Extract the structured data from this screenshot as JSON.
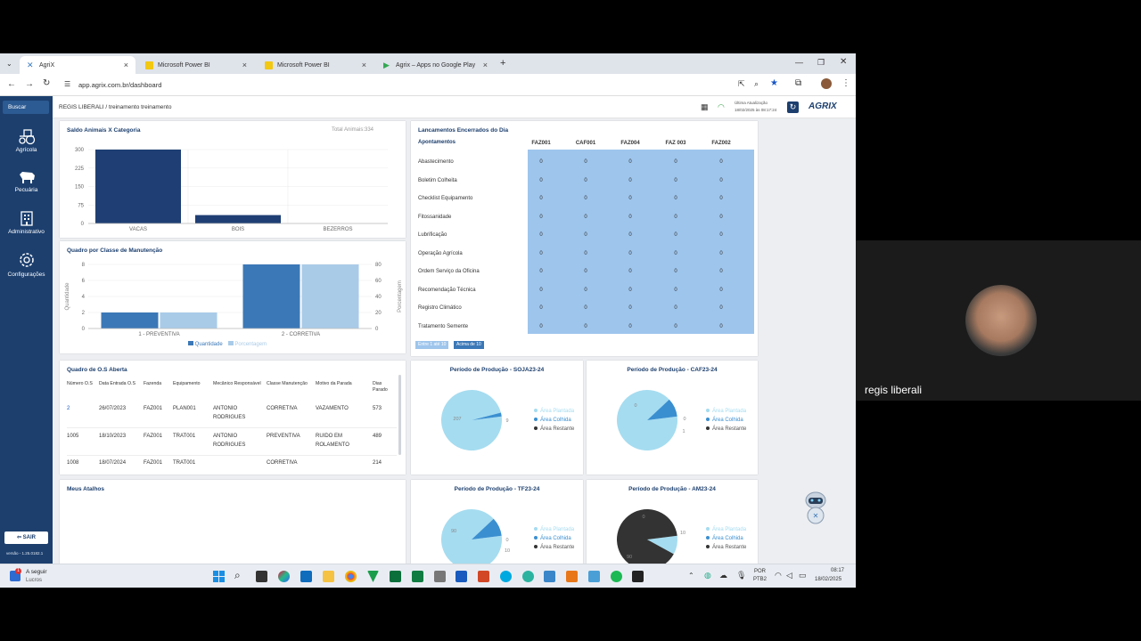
{
  "browser": {
    "tabs": [
      {
        "label": "AgriX"
      },
      {
        "label": "Microsoft Power BI"
      },
      {
        "label": "Microsoft Power BI"
      },
      {
        "label": "Agrix – Apps no Google Play"
      }
    ],
    "url": "app.agrix.com.br/dashboard"
  },
  "sidebar": {
    "search_label": "Buscar",
    "items": [
      {
        "label": "Agrícola",
        "icon": "tractor-icon"
      },
      {
        "label": "Pecuária",
        "icon": "cow-icon"
      },
      {
        "label": "Administrativo",
        "icon": "building-icon"
      },
      {
        "label": "Configurações",
        "icon": "gear-icon"
      }
    ],
    "logout_label": "SAIR",
    "version": "versão - 1.25.0182.1"
  },
  "header": {
    "breadcrumb": "REGIS LIBERALI / treinamento treinamento",
    "update_label": "Última Atualização",
    "update_time": "18/02/2025 às 08:17:24",
    "logo": "AGRIX"
  },
  "animals_card": {
    "title": "Saldo Animais X Categoria",
    "total": "Total Animais:334"
  },
  "maintenance_card": {
    "title": "Quadro por Classe de Manutenção",
    "legend_qty": "Quantidade",
    "legend_pct": "Porcentagem"
  },
  "releases_card": {
    "title": "Lancamentos Encerrados do Dia",
    "col_header": "Apontamentos",
    "farms": [
      "FAZ001",
      "CAF001",
      "FAZ004",
      "FAZ 003",
      "FAZ002"
    ],
    "rows": [
      {
        "label": "Abastecimento",
        "values": [
          "0",
          "0",
          "0",
          "0",
          "0"
        ]
      },
      {
        "label": "Boletim Colheita",
        "values": [
          "0",
          "0",
          "0",
          "0",
          "0"
        ]
      },
      {
        "label": "Checklist Equipamento",
        "values": [
          "0",
          "0",
          "0",
          "0",
          "0"
        ]
      },
      {
        "label": "Fitossanidade",
        "values": [
          "0",
          "0",
          "0",
          "0",
          "0"
        ]
      },
      {
        "label": "Lubrificação",
        "values": [
          "0",
          "0",
          "0",
          "0",
          "0"
        ]
      },
      {
        "label": "Operação Agrícola",
        "values": [
          "0",
          "0",
          "0",
          "0",
          "0"
        ]
      },
      {
        "label": "Ordem Serviço da Oficina",
        "values": [
          "0",
          "0",
          "0",
          "0",
          "0"
        ]
      },
      {
        "label": "Recomendação Técnica",
        "values": [
          "0",
          "0",
          "0",
          "0",
          "0"
        ]
      },
      {
        "label": "Registro Climático",
        "values": [
          "0",
          "0",
          "0",
          "0",
          "0"
        ]
      },
      {
        "label": "Tratamento Semente",
        "values": [
          "0",
          "0",
          "0",
          "0",
          "0"
        ]
      }
    ],
    "badge_low": "Entre 1 até 10",
    "badge_high": "Acima de 10"
  },
  "os_card": {
    "title": "Quadro de O.S Aberta",
    "headers": [
      "Número O.S",
      "Data Entrada O.S",
      "Fazenda",
      "Equipamento",
      "Mecânico Responsável",
      "Classe Manutenção",
      "Motivo da Parada",
      "Dias Parado"
    ],
    "rows": [
      [
        "2",
        "26/07/2023",
        "FAZ001",
        "PLAN001",
        "ANTONIO RODRIGUES",
        "CORRETIVA",
        "VAZAMENTO",
        "573"
      ],
      [
        "1005",
        "18/10/2023",
        "FAZ001",
        "TRAT001",
        "ANTONIO RODRIGUES",
        "PREVENTIVA",
        "RUIDO EM ROLAMENTO",
        "489"
      ],
      [
        "1008",
        "18/07/2024",
        "FAZ001",
        "TRAT001",
        "",
        "CORRETIVA",
        "",
        "214"
      ]
    ]
  },
  "shortcuts_card": {
    "title": "Meus Atalhos"
  },
  "pie_legend": {
    "planted": "Área Plantada",
    "harvested": "Área Colhida",
    "remaining": "Área Restante"
  },
  "pies": [
    {
      "title": "Período de Produção - SOJA23-24",
      "labels": [
        "207",
        "9"
      ]
    },
    {
      "title": "Período de Produção - CAF23-24",
      "labels": [
        "0",
        "0",
        "1"
      ]
    },
    {
      "title": "Período de Produção - TF23-24",
      "labels": [
        "90",
        "0",
        "10"
      ]
    },
    {
      "title": "Período de Produção - AM23-24",
      "labels": [
        "0",
        "10",
        "90"
      ]
    }
  ],
  "taskbar": {
    "weather_title": "A seguir",
    "weather_sub": "Lucros",
    "lang1": "POR",
    "lang2": "PTB2",
    "time": "08:17",
    "date": "18/02/2025"
  },
  "video": {
    "name": "regis liberali"
  },
  "chart_data": [
    {
      "type": "bar",
      "title": "Saldo Animais X Categoria",
      "categories": [
        "VACAS",
        "BOIS",
        "BEZERROS"
      ],
      "values": [
        300,
        34,
        0
      ],
      "yticks": [
        "0",
        "75",
        "150",
        "225",
        "300"
      ],
      "ylim": [
        0,
        300
      ],
      "colors": {
        "bar": "#1f3f74"
      }
    },
    {
      "type": "bar",
      "title": "Quadro por Classe de Manutenção",
      "categories": [
        "1 - PREVENTIVA",
        "2 - CORRETIVA"
      ],
      "series": [
        {
          "name": "Quantidade",
          "values": [
            2,
            8
          ],
          "color": "#3b78b7"
        },
        {
          "name": "Porcentagem",
          "values": [
            20,
            80
          ],
          "color": "#a9cbe8"
        }
      ],
      "ylabel": "Quantidade",
      "y2label": "Porcentagem",
      "yticks": [
        "0",
        "2",
        "4",
        "6",
        "8"
      ],
      "y2ticks": [
        "0",
        "20",
        "40",
        "60",
        "80"
      ],
      "ylim": [
        0,
        8
      ],
      "y2lim": [
        0,
        80
      ]
    }
  ]
}
